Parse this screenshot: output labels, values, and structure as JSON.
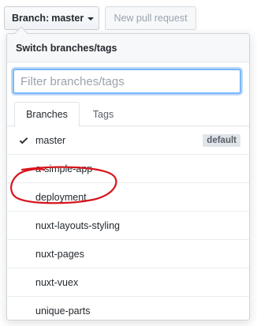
{
  "toolbar": {
    "branch_label": "Branch:",
    "branch_value": "master",
    "new_pr_label": "New pull request"
  },
  "dropdown": {
    "header": "Switch branches/tags",
    "filter_placeholder": "Filter branches/tags",
    "filter_value": "",
    "tabs": [
      {
        "label": "Branches",
        "active": true
      },
      {
        "label": "Tags",
        "active": false
      }
    ],
    "branches": [
      {
        "name": "master",
        "selected": true,
        "badge": "default"
      },
      {
        "name": "a-simple-app"
      },
      {
        "name": "deployment",
        "circled": true
      },
      {
        "name": "nuxt-layouts-styling"
      },
      {
        "name": "nuxt-pages"
      },
      {
        "name": "nuxt-vuex"
      },
      {
        "name": "unique-parts"
      }
    ]
  },
  "annotation": {
    "color": "#d8141c"
  },
  "colors": {
    "accent": "#0366d6",
    "focus_border": "#79b8ff"
  },
  "icons": [
    "caret-down-icon",
    "check-icon"
  ]
}
